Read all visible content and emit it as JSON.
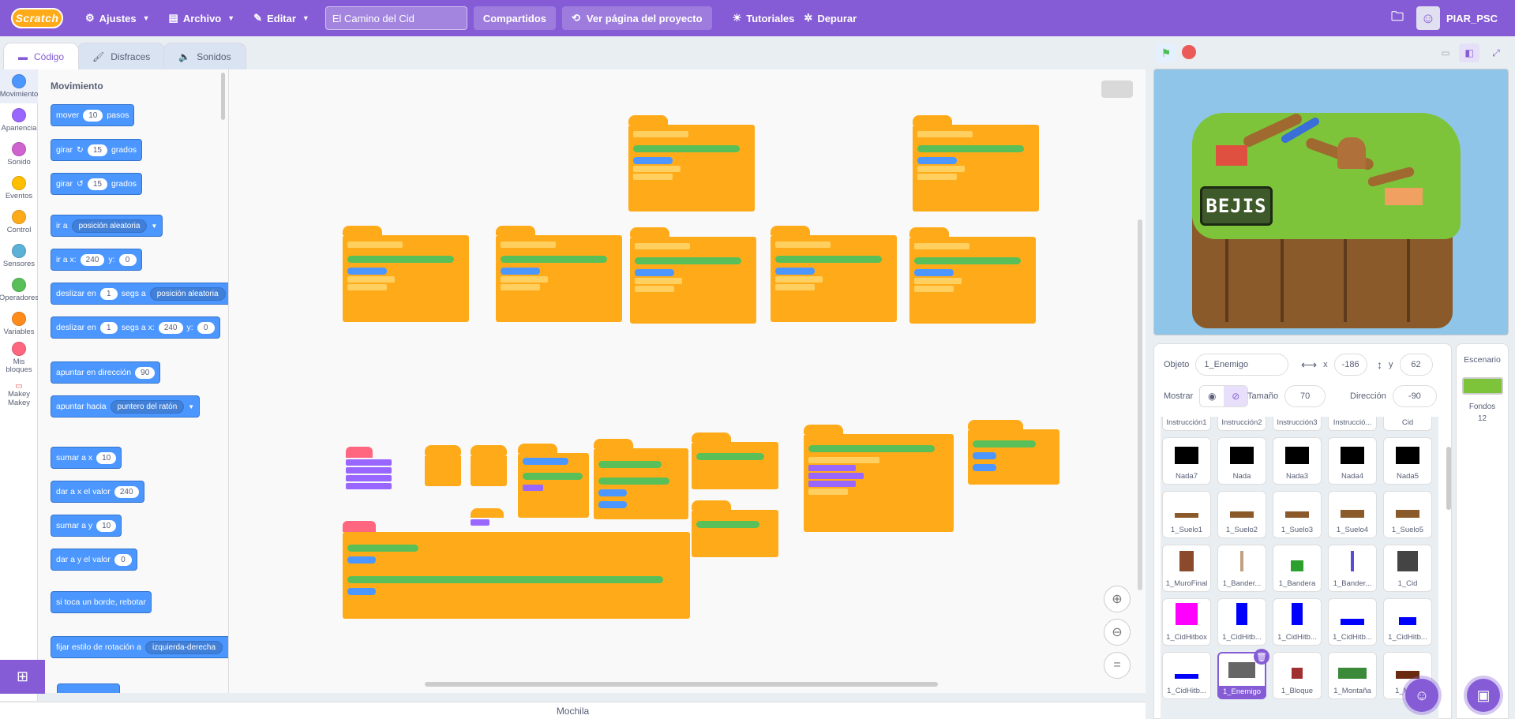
{
  "menubar": {
    "logo": "Scratch",
    "settings": "Ajustes",
    "file": "Archivo",
    "edit": "Editar",
    "project_title": "El Camino del Cid",
    "shared": "Compartidos",
    "see_project": "Ver página del proyecto",
    "tutorials": "Tutoriales",
    "debug": "Depurar",
    "username": "PIAR_PSC"
  },
  "tabs": [
    "Código",
    "Disfraces",
    "Sonidos"
  ],
  "categories": [
    {
      "label": "Movimiento",
      "color": "#4c97ff"
    },
    {
      "label": "Apariencia",
      "color": "#9966ff"
    },
    {
      "label": "Sonido",
      "color": "#cf63cf"
    },
    {
      "label": "Eventos",
      "color": "#ffbf00"
    },
    {
      "label": "Control",
      "color": "#ffab19"
    },
    {
      "label": "Sensores",
      "color": "#5cb1d6"
    },
    {
      "label": "Operadores",
      "color": "#59c059"
    },
    {
      "label": "Variables",
      "color": "#ff8c1a"
    },
    {
      "label": "Mis bloques",
      "color": "#ff6680"
    },
    {
      "label": "Makey Makey",
      "color": ""
    }
  ],
  "palette": {
    "title": "Movimiento",
    "move": {
      "a": "mover",
      "v": "10",
      "b": "pasos"
    },
    "turn_right": {
      "a": "girar",
      "v": "15",
      "b": "grados"
    },
    "turn_left": {
      "a": "girar",
      "v": "15",
      "b": "grados"
    },
    "goto": {
      "a": "ir a",
      "d": "posición aleatoria"
    },
    "goto_xy": {
      "a": "ir a x:",
      "x": "240",
      "b": "y:",
      "y": "0"
    },
    "glide_to": {
      "a": "deslizar en",
      "v": "1",
      "b": "segs a",
      "d": "posición aleatoria"
    },
    "glide_xy": {
      "a": "deslizar en",
      "v": "1",
      "b": "segs a x:",
      "x": "240",
      "c": "y:",
      "y": "0"
    },
    "point_dir": {
      "a": "apuntar en dirección",
      "v": "90"
    },
    "point_to": {
      "a": "apuntar hacia",
      "d": "puntero del ratón"
    },
    "change_x": {
      "a": "sumar a x",
      "v": "10"
    },
    "set_x": {
      "a": "dar a x el valor",
      "v": "240"
    },
    "change_y": {
      "a": "sumar a y",
      "v": "10"
    },
    "set_y": {
      "a": "dar a y el valor",
      "v": "0"
    },
    "bounce": "si toca un borde, rebotar",
    "rotation": {
      "a": "fijar estilo de rotación a",
      "d": "izquierda-derecha"
    }
  },
  "sprite_info": {
    "label_object": "Objeto",
    "name": "1_Enemigo",
    "label_x": "x",
    "x": "-186",
    "label_y": "y",
    "y": "62",
    "label_show": "Mostrar",
    "label_size": "Tamaño",
    "size": "70",
    "label_direction": "Dirección",
    "direction": "-90"
  },
  "sprites": [
    {
      "name": "Instrucción1"
    },
    {
      "name": "Instrucción2"
    },
    {
      "name": "Instrucción3"
    },
    {
      "name": "Instrucció..."
    },
    {
      "name": "Cid"
    },
    {
      "name": "Nada7"
    },
    {
      "name": "Nada"
    },
    {
      "name": "Nada3"
    },
    {
      "name": "Nada4"
    },
    {
      "name": "Nada5"
    },
    {
      "name": "1_Suelo1"
    },
    {
      "name": "1_Suelo2"
    },
    {
      "name": "1_Suelo3"
    },
    {
      "name": "1_Suelo4"
    },
    {
      "name": "1_Suelo5"
    },
    {
      "name": "1_MuroFinal"
    },
    {
      "name": "1_Bander..."
    },
    {
      "name": "1_Bandera"
    },
    {
      "name": "1_Bander..."
    },
    {
      "name": "1_Cid"
    },
    {
      "name": "1_CidHitbox"
    },
    {
      "name": "1_CidHitb..."
    },
    {
      "name": "1_CidHitb..."
    },
    {
      "name": "1_CidHitb..."
    },
    {
      "name": "1_CidHitb..."
    },
    {
      "name": "1_CidHitb..."
    },
    {
      "name": "1_Enemigo"
    },
    {
      "name": "1_Bloque"
    },
    {
      "name": "1_Montaña"
    },
    {
      "name": "1_Mu..."
    }
  ],
  "stage_pane": {
    "title": "Escenario",
    "backdrops_label": "Fondos",
    "backdrops_count": "12"
  },
  "stage": {
    "sign_text": "BEJIS"
  },
  "backpack": "Mochila"
}
